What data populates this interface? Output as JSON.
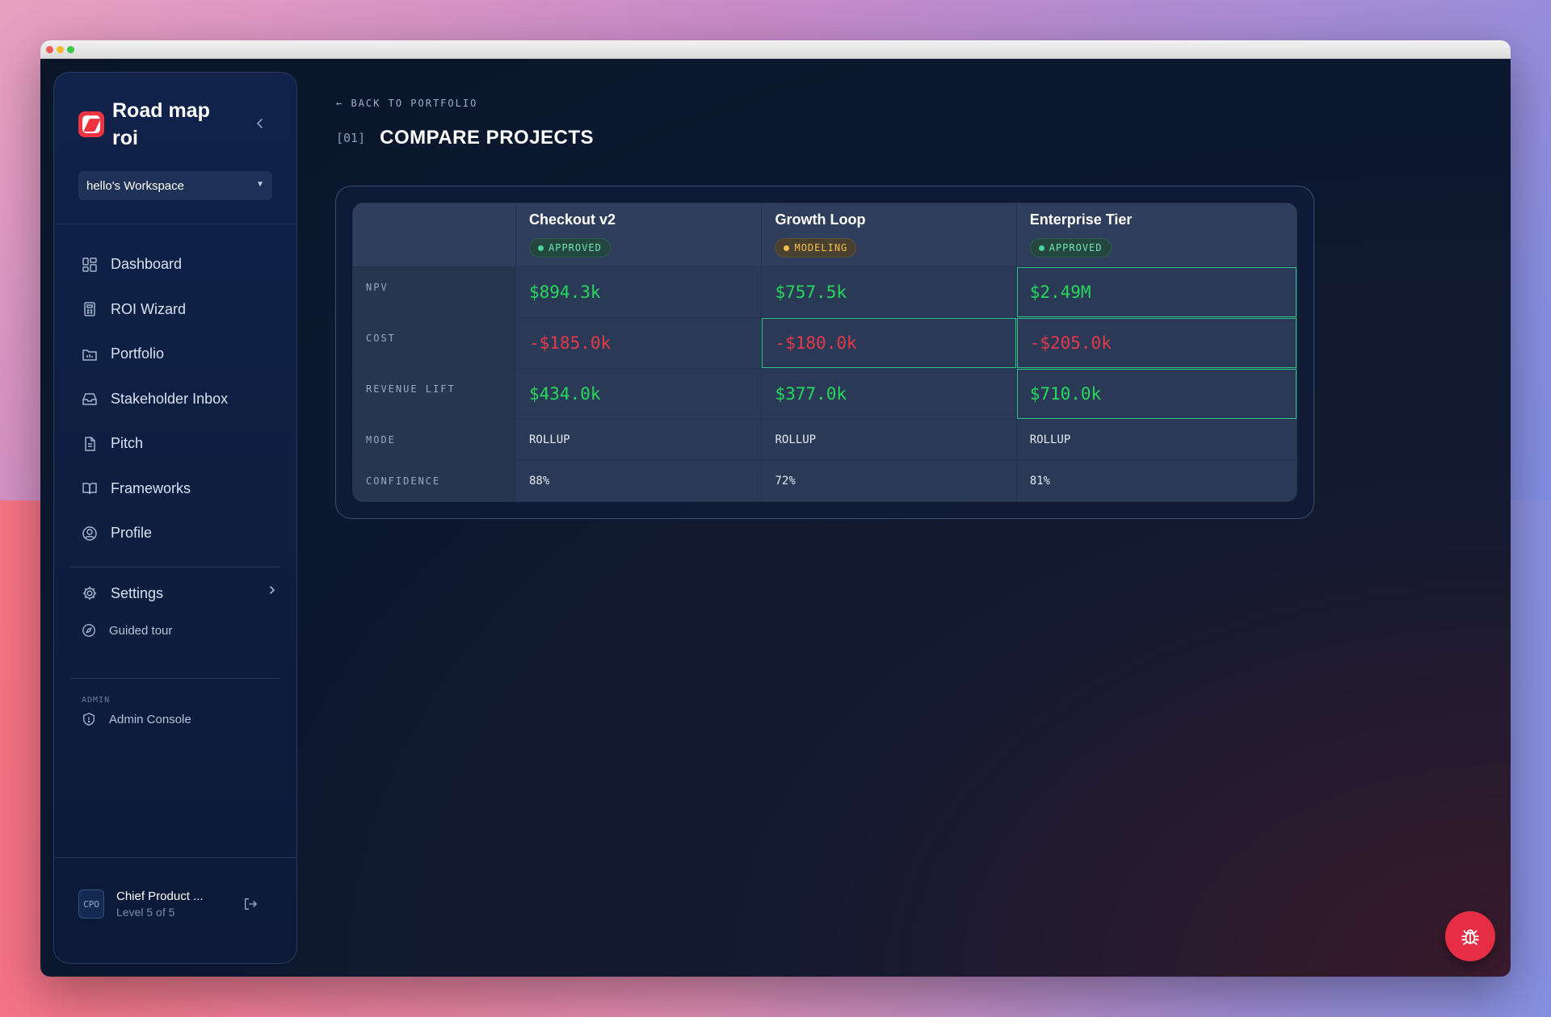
{
  "app": {
    "name": "Road map roi",
    "workspace": "hello's Workspace"
  },
  "nav": {
    "items": [
      {
        "label": "Dashboard",
        "icon": "dashboard-icon"
      },
      {
        "label": "ROI Wizard",
        "icon": "calculator-icon"
      },
      {
        "label": "Portfolio",
        "icon": "folder-chart-icon"
      },
      {
        "label": "Stakeholder Inbox",
        "icon": "inbox-icon"
      },
      {
        "label": "Pitch",
        "icon": "document-icon"
      },
      {
        "label": "Frameworks",
        "icon": "book-icon"
      },
      {
        "label": "Profile",
        "icon": "user-circle-icon"
      }
    ],
    "settings": "Settings",
    "guided_tour": "Guided tour",
    "admin_label": "ADMIN",
    "admin_console": "Admin Console"
  },
  "user": {
    "avatar": "CPO",
    "name": "Chief Product ...",
    "level": "Level 5 of 5"
  },
  "page": {
    "back": "BACK TO PORTFOLIO",
    "number": "[01]",
    "title": "COMPARE PROJECTS"
  },
  "compare": {
    "projects": [
      {
        "name": "Checkout v2",
        "status": "APPROVED"
      },
      {
        "name": "Growth Loop",
        "status": "MODELING"
      },
      {
        "name": "Enterprise Tier",
        "status": "APPROVED"
      }
    ],
    "rows": [
      {
        "label": "NPV",
        "values": [
          "$894.3k",
          "$757.5k",
          "$2.49M"
        ]
      },
      {
        "label": "COST",
        "values": [
          "-$185.0k",
          "-$180.0k",
          "-$205.0k"
        ]
      },
      {
        "label": "REVENUE LIFT",
        "values": [
          "$434.0k",
          "$377.0k",
          "$710.0k"
        ]
      },
      {
        "label": "MODE",
        "values": [
          "ROLLUP",
          "ROLLUP",
          "ROLLUP"
        ]
      },
      {
        "label": "CONFIDENCE",
        "values": [
          "88%",
          "72%",
          "81%"
        ]
      }
    ]
  },
  "colors": {
    "positive": "#26d95c",
    "negative": "#e33a4c",
    "approved": "#48d79a",
    "modeling": "#f4c04a",
    "highlight": "#2fc48a",
    "brand": "#ef3340"
  }
}
